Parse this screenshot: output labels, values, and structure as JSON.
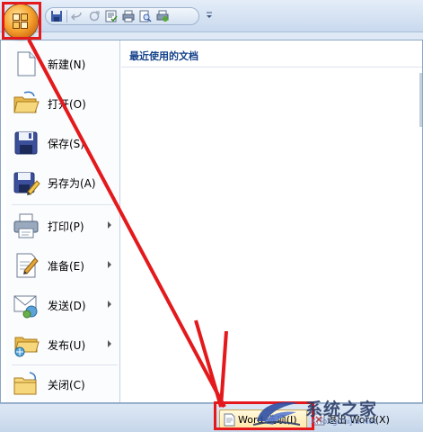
{
  "quick_access": {
    "buttons": [
      "save-icon",
      "undo-icon",
      "redo-icon",
      "spelling-icon",
      "print-icon",
      "print-preview-icon",
      "quick-print-icon"
    ]
  },
  "menu": {
    "items": [
      {
        "label": "新建(N)",
        "icon": "new-document-icon",
        "submenu": false
      },
      {
        "label": "打开(O)",
        "icon": "open-folder-icon",
        "submenu": false
      },
      {
        "label": "保存(S)",
        "icon": "save-disk-icon",
        "submenu": false
      },
      {
        "label": "另存为(A)",
        "icon": "save-as-icon",
        "submenu": false
      },
      {
        "label": "打印(P)",
        "icon": "printer-icon",
        "submenu": true
      },
      {
        "label": "准备(E)",
        "icon": "prepare-icon",
        "submenu": true
      },
      {
        "label": "发送(D)",
        "icon": "send-icon",
        "submenu": true
      },
      {
        "label": "发布(U)",
        "icon": "publish-icon",
        "submenu": true
      },
      {
        "label": "关闭(C)",
        "icon": "close-folder-icon",
        "submenu": false
      }
    ],
    "recent_documents_title": "最近使用的文档"
  },
  "bottom": {
    "options_label": "Word 选项(I)",
    "exit_label": "退出 Word(X)"
  },
  "watermark": {
    "text": "系统之家",
    "url": "XiTongZhiJia.Net"
  },
  "annotation_color": "#e3191c"
}
